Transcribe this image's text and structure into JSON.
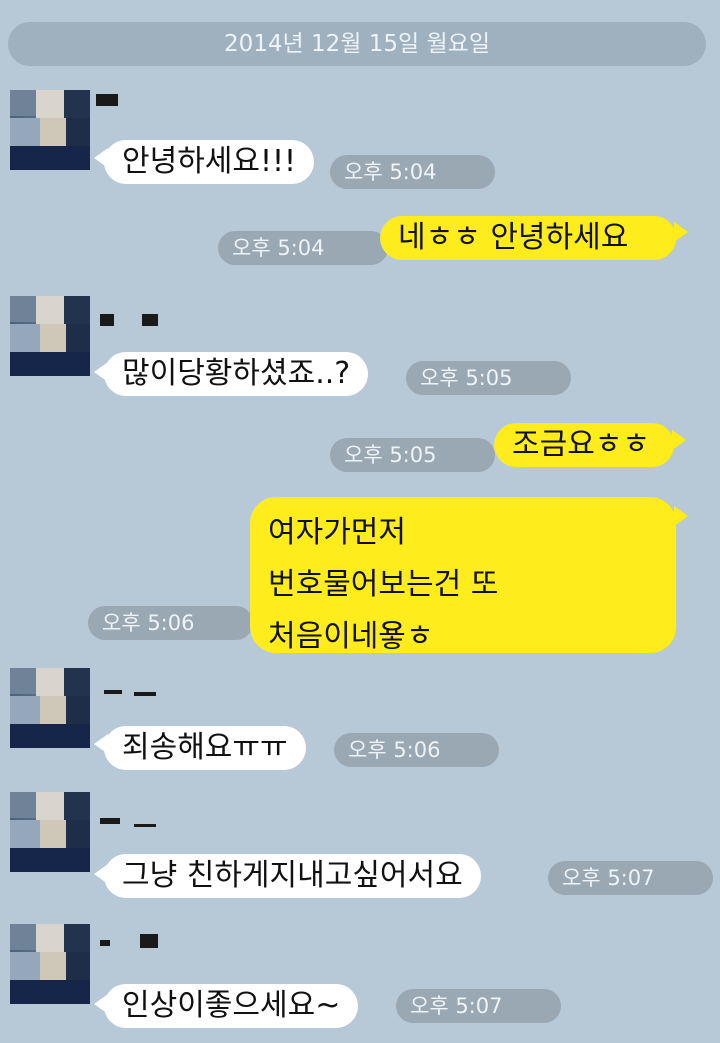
{
  "date_divider": "2014년 12월 15일 월요일",
  "messages": [
    {
      "side": "in",
      "text": "안녕하세요!!!",
      "time": "오후 5:04"
    },
    {
      "side": "out",
      "text": "네ㅎㅎ 안녕하세요",
      "time": "오후 5:04"
    },
    {
      "side": "in",
      "text": "많이당황하셨죠..?",
      "time": "오후 5:05"
    },
    {
      "side": "out",
      "text": "조금요ㅎㅎ",
      "time": "오후 5:05"
    },
    {
      "side": "out",
      "lines": [
        "여자가먼저",
        "번호물어보는건 또",
        "처음이네욯ㅎ"
      ],
      "time": "오후 5:06"
    },
    {
      "side": "in",
      "text": "죄송해요ㅠㅠ",
      "time": "오후 5:06"
    },
    {
      "side": "in",
      "text": "그냥 친하게지내고싶어서요",
      "time": "오후 5:07"
    },
    {
      "side": "in",
      "text": "인상이좋으세요~",
      "time": "오후 5:07"
    }
  ],
  "colors": {
    "background": "#b7c8d7",
    "outgoing_bubble": "#ffec1c",
    "incoming_bubble": "#ffffff",
    "time_pill": "#9aa8b3",
    "date_pill": "#9fb0bf"
  }
}
